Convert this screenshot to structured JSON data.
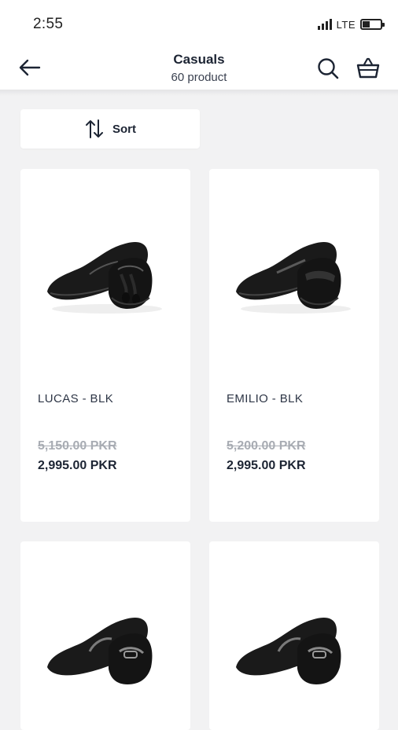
{
  "status_bar": {
    "time": "2:55",
    "network": "LTE"
  },
  "header": {
    "title": "Casuals",
    "subtitle": "60 product"
  },
  "sort": {
    "label": "Sort"
  },
  "products": [
    {
      "name": "LUCAS - BLK",
      "old_price": "5,150.00 PKR",
      "price": "2,995.00 PKR"
    },
    {
      "name": "EMILIO - BLK",
      "old_price": "5,200.00 PKR",
      "price": "2,995.00 PKR"
    },
    {
      "name": "",
      "old_price": "",
      "price": ""
    },
    {
      "name": "",
      "old_price": "",
      "price": ""
    }
  ],
  "colors": {
    "background": "#f2f2f3",
    "text_dark": "#1c2433",
    "strike_gray": "#a8acb3",
    "card": "#ffffff"
  },
  "icons": [
    "back-arrow-icon",
    "search-icon",
    "basket-icon",
    "sort-arrows-icon",
    "signal-icon",
    "battery-icon"
  ]
}
